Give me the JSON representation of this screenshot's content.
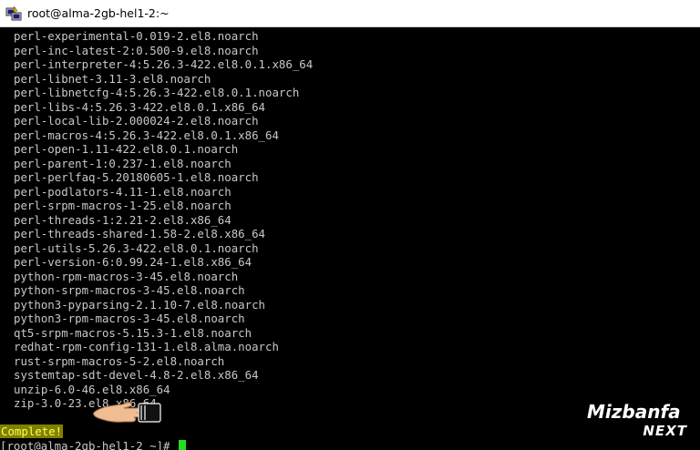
{
  "window": {
    "title": "root@alma-2gb-hel1-2:~"
  },
  "terminal": {
    "lines": [
      "perl-experimental-0.019-2.el8.noarch",
      "perl-inc-latest-2:0.500-9.el8.noarch",
      "perl-interpreter-4:5.26.3-422.el8.0.1.x86_64",
      "perl-libnet-3.11-3.el8.noarch",
      "perl-libnetcfg-4:5.26.3-422.el8.0.1.noarch",
      "perl-libs-4:5.26.3-422.el8.0.1.x86_64",
      "perl-local-lib-2.000024-2.el8.noarch",
      "perl-macros-4:5.26.3-422.el8.0.1.x86_64",
      "perl-open-1.11-422.el8.0.1.noarch",
      "perl-parent-1:0.237-1.el8.noarch",
      "perl-perlfaq-5.20180605-1.el8.noarch",
      "perl-podlators-4.11-1.el8.noarch",
      "perl-srpm-macros-1-25.el8.noarch",
      "perl-threads-1:2.21-2.el8.x86_64",
      "perl-threads-shared-1.58-2.el8.x86_64",
      "perl-utils-5.26.3-422.el8.0.1.noarch",
      "perl-version-6:0.99.24-1.el8.x86_64",
      "python-rpm-macros-3-45.el8.noarch",
      "python-srpm-macros-3-45.el8.noarch",
      "python3-pyparsing-2.1.10-7.el8.noarch",
      "python3-rpm-macros-3-45.el8.noarch",
      "qt5-srpm-macros-5.15.3-1.el8.noarch",
      "redhat-rpm-config-131-1.el8.alma.noarch",
      "rust-srpm-macros-5-2.el8.noarch",
      "systemtap-sdt-devel-4.8-2.el8.x86_64",
      "unzip-6.0-46.el8.x86_64",
      "zip-3.0-23.el8.x86_64"
    ],
    "complete_text": "Complete!",
    "prompt": "[root@alma-2gb-hel1-2 ~]# "
  },
  "logo": {
    "top_text": "Mizbanfa",
    "bottom_text": "NEXT"
  },
  "colors": {
    "terminal_bg": "#000000",
    "terminal_fg": "#c8c8c8",
    "complete_bg": "#808000",
    "complete_fg": "#ffff55",
    "cursor": "#1fe01f"
  },
  "icons": {
    "app": "putty-terminal-icon",
    "pointer": "pointing-hand-icon"
  }
}
